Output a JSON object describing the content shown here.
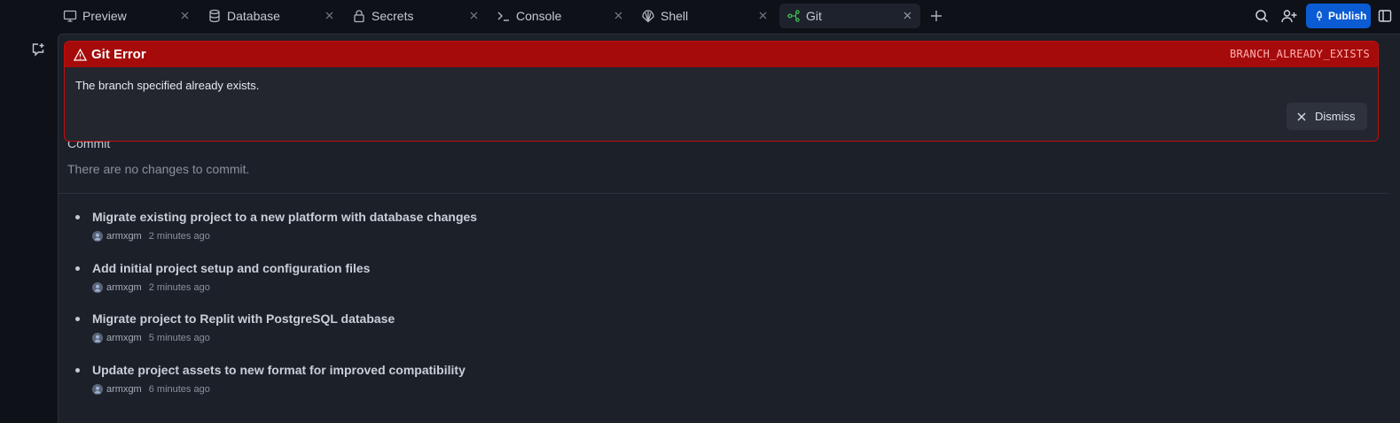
{
  "tabs": [
    {
      "label": "Preview",
      "icon": "monitor-icon",
      "active": false
    },
    {
      "label": "Database",
      "icon": "database-icon",
      "active": false
    },
    {
      "label": "Secrets",
      "icon": "lock-icon",
      "active": false
    },
    {
      "label": "Console",
      "icon": "terminal-icon",
      "active": false
    },
    {
      "label": "Shell",
      "icon": "shell-icon",
      "active": false
    },
    {
      "label": "Git",
      "icon": "git-branch-icon",
      "active": true
    }
  ],
  "header": {
    "publish_label": "Publish",
    "accent_color": "#0b5bd3"
  },
  "git": {
    "commit_heading": "Commit",
    "commit_empty": "There are no changes to commit.",
    "commits": [
      {
        "message": "Migrate existing project to a new platform with database changes",
        "author": "armxgm",
        "time": "2 minutes ago"
      },
      {
        "message": "Add initial project setup and configuration files",
        "author": "armxgm",
        "time": "2 minutes ago"
      },
      {
        "message": "Migrate project to Replit with PostgreSQL database",
        "author": "armxgm",
        "time": "5 minutes ago"
      },
      {
        "message": "Update project assets to new format for improved compatibility",
        "author": "armxgm",
        "time": "6 minutes ago"
      }
    ]
  },
  "error": {
    "title": "Git Error",
    "code": "BRANCH_ALREADY_EXISTS",
    "message": "The branch specified already exists.",
    "dismiss_label": "Dismiss",
    "color": "#a60b0b"
  }
}
